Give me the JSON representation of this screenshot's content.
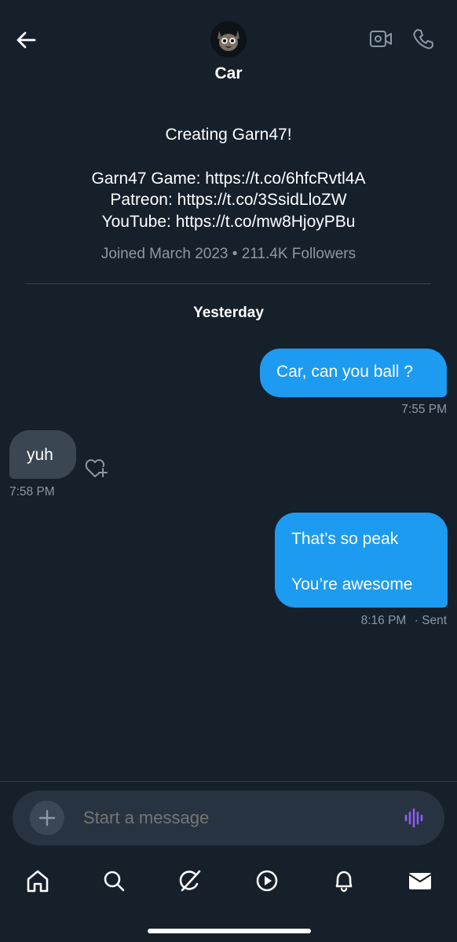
{
  "header": {
    "contact_name": "Car",
    "icons": [
      "back-arrow-icon",
      "avatar-image",
      "video-icon",
      "phone-icon"
    ]
  },
  "profile": {
    "bio_headline": "Creating Garn47!",
    "links": [
      "Garn47 Game: https://t.co/6hfcRvtl4A",
      "Patreon: https://t.co/3SsidLloZW",
      "YouTube: https://t.co/mw8HjoyPBu"
    ],
    "joined": "Joined March 2023 • 211.4K Followers"
  },
  "conversation": {
    "date_label": "Yesterday",
    "messages": [
      {
        "direction": "out",
        "text": "Car, can you ball ?",
        "time": "7:55 PM"
      },
      {
        "direction": "in",
        "text": "yuh",
        "time": "7:58 PM"
      },
      {
        "direction": "out",
        "lines": [
          "That’s so peak",
          "You’re awesome"
        ],
        "time": "8:16 PM",
        "status": "· Sent"
      }
    ]
  },
  "composer": {
    "placeholder": "Start a message"
  },
  "tabbar": {
    "items": [
      "home-icon",
      "search-icon",
      "grok-icon",
      "video-play-icon",
      "notifications-bell-icon",
      "messages-envelope-icon"
    ]
  },
  "colors": {
    "background": "#15202b",
    "accent": "#1d9bf0",
    "incoming_bubble": "#3a4651",
    "muted_text": "#8b98a5",
    "voice_icon": "#8b5cf6"
  }
}
